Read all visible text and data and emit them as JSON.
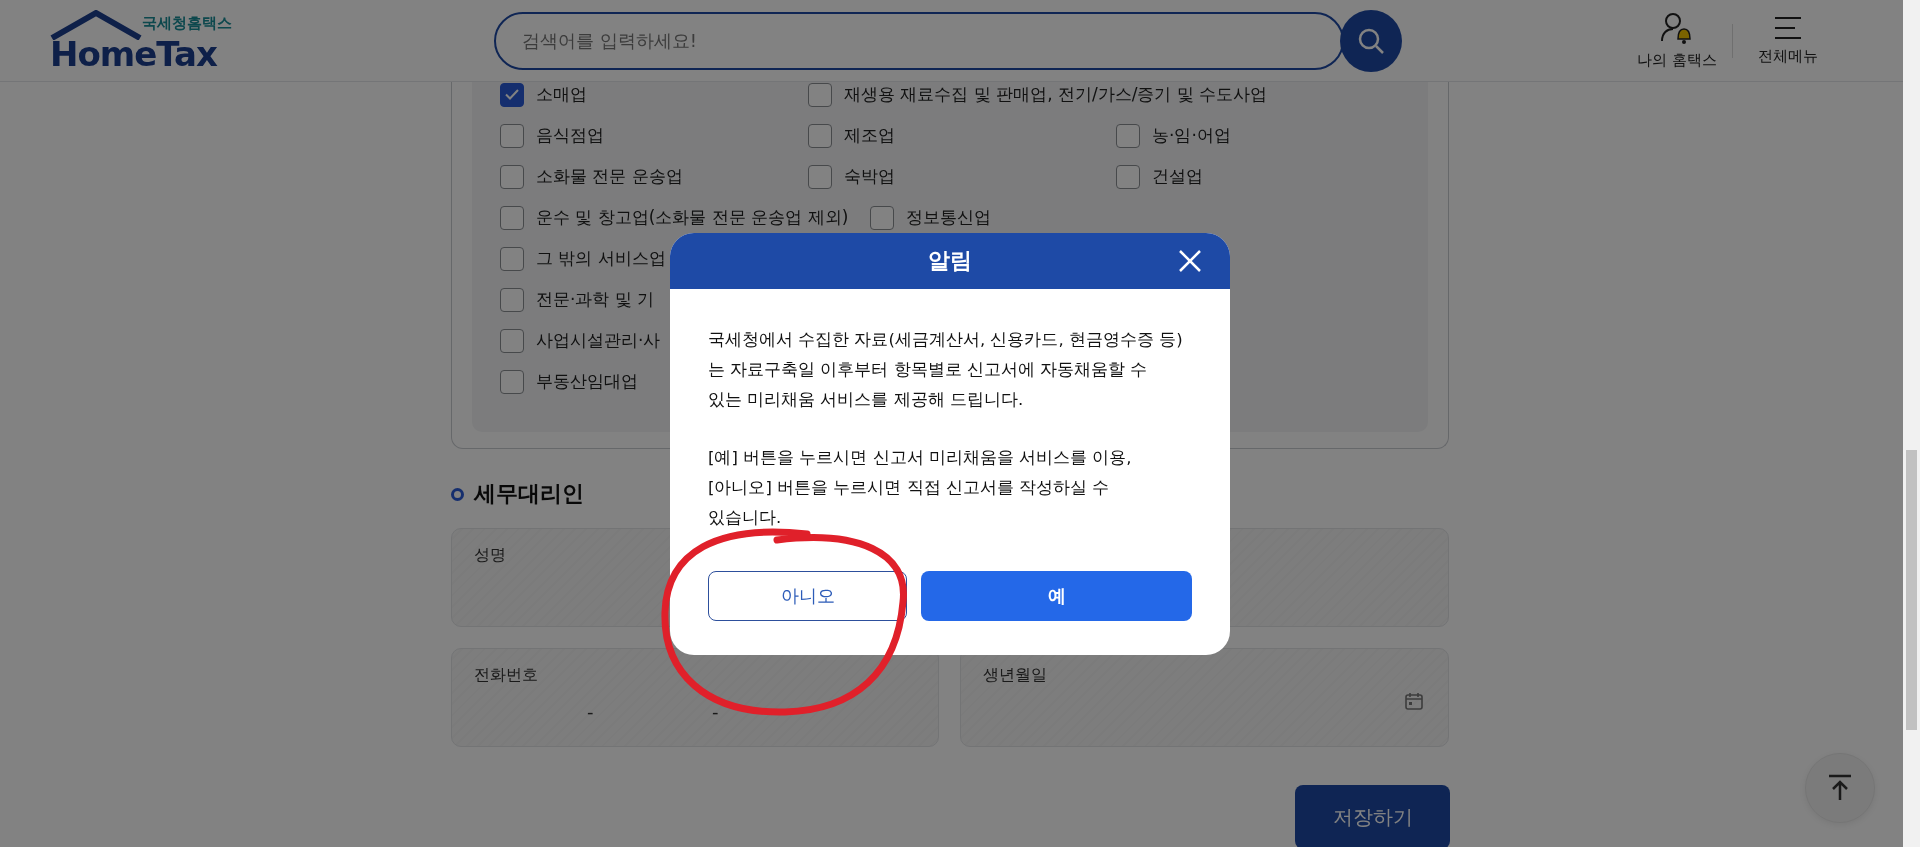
{
  "header": {
    "logo": {
      "subtitle": "국세청홈택스",
      "name": "HomeTax"
    },
    "search": {
      "placeholder": "검색어를 입력하세요!"
    },
    "nav": [
      {
        "label": "나의 홈택스",
        "kind": "user"
      },
      {
        "label": "전체메뉴",
        "kind": "menu"
      }
    ]
  },
  "business_types": [
    {
      "items": [
        {
          "label": "소매업",
          "checked": true
        },
        {
          "label": "재생용 재료수집 및 판매업, 전기/가스/증기 및 수도사업",
          "checked": false
        }
      ]
    },
    {
      "items": [
        {
          "label": "음식점업",
          "checked": false
        },
        {
          "label": "제조업",
          "checked": false
        },
        {
          "label": "농·임·어업",
          "checked": false
        }
      ]
    },
    {
      "items": [
        {
          "label": "소화물 전문 운송업",
          "checked": false
        },
        {
          "label": "숙박업",
          "checked": false
        },
        {
          "label": "건설업",
          "checked": false
        }
      ]
    },
    {
      "items": [
        {
          "label": "운수 및 창고업(소화물 전문 운송업 제외)",
          "checked": false
        },
        {
          "label": "정보통신업",
          "checked": false
        }
      ]
    },
    {
      "items": [
        {
          "label": "그 밖의 서비스업",
          "checked": false
        }
      ]
    },
    {
      "items": [
        {
          "label": "전문·과학 및 기",
          "checked": false
        }
      ]
    },
    {
      "items": [
        {
          "label": "사업시설관리·사",
          "checked": false
        }
      ]
    },
    {
      "items": [
        {
          "label": "부동산임대업",
          "checked": false
        }
      ]
    }
  ],
  "section": {
    "title": "세무대리인"
  },
  "fields": [
    {
      "kind": "text",
      "label": "성명"
    },
    {
      "kind": "blank"
    },
    {
      "kind": "phone",
      "label": "전화번호",
      "separators": [
        "-",
        "-"
      ]
    },
    {
      "kind": "date",
      "label": "생년월일"
    }
  ],
  "save_button": "저장하기",
  "dialog": {
    "title": "알림",
    "paragraphs": [
      {
        "lines": [
          "국세청에서 수집한 자료(세금계산서, 신용카드, 현금영수증 등)",
          "는 자료구축일 이후부터 항목별로 신고서에 자동채움할 수",
          "있는 미리채움 서비스를 제공해 드립니다."
        ]
      },
      {
        "lines": [
          "[예] 버튼을 누르시면 신고서 미리채움을 서비스를 이용,",
          "[아니오] 버튼을 누르시면 직접 신고서를 작성하실 수",
          "있습니다."
        ]
      }
    ],
    "buttons": [
      {
        "label": "아니오",
        "kind": "secondary"
      },
      {
        "label": "예",
        "kind": "primary"
      }
    ]
  }
}
